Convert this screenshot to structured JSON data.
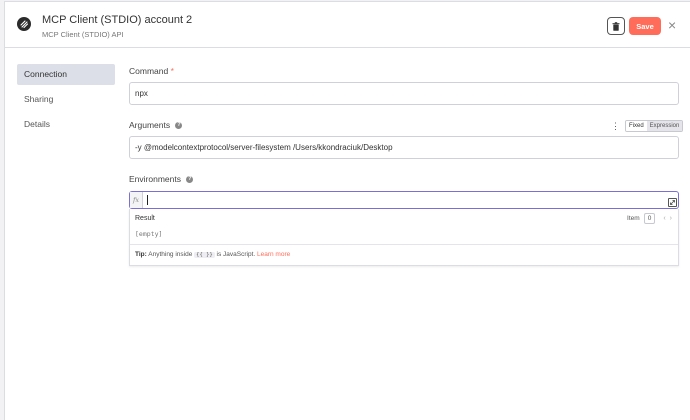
{
  "header": {
    "title": "MCP Client (STDIO) account 2",
    "subtitle": "MCP Client (STDIO) API",
    "save_label": "Save",
    "close_label": "×"
  },
  "sidebar": {
    "items": [
      {
        "label": "Connection",
        "active": true
      },
      {
        "label": "Sharing",
        "active": false
      },
      {
        "label": "Details",
        "active": false
      }
    ]
  },
  "fields": {
    "command": {
      "label": "Command",
      "required_mark": "*",
      "value": "npx"
    },
    "arguments": {
      "label": "Arguments",
      "value": "-y @modelcontextprotocol/server-filesystem /Users/kkondraciuk/Desktop",
      "toggle_fixed": "Fixed",
      "toggle_expression": "Expression"
    },
    "environments": {
      "label": "Environments",
      "fx_label": "fx",
      "value": ""
    }
  },
  "result": {
    "title": "Result",
    "item_label": "Item",
    "item_index": "0",
    "empty_text": "[empty]",
    "tip_label": "Tip:",
    "tip_text": "Anything inside",
    "tip_code": "{{ }}",
    "tip_text2": "is JavaScript.",
    "learn_more": "Learn more"
  },
  "colors": {
    "accent": "#ff6d5a",
    "focus": "#7b6fd6"
  },
  "icons": [
    "mcp-logo-icon",
    "trash-icon",
    "close-icon",
    "help-icon",
    "kebab-menu-icon",
    "expand-icon",
    "chevron-left-icon",
    "chevron-right-icon"
  ]
}
